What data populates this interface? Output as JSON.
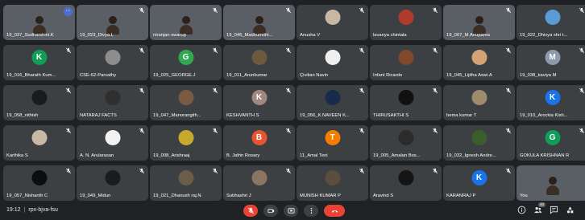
{
  "meeting": {
    "time": "19:12",
    "separator": "|",
    "code": "rpx-bjva-fsu"
  },
  "participants_badge": "40",
  "colors": {
    "background": "#202124",
    "tile": "#3c4043",
    "end_call": "#ea4335",
    "pin_badge": "#4b6fd1"
  },
  "tiles": [
    {
      "name": "19_037_Sudharshini.K",
      "avatar_type": "video",
      "photo": "pic-a",
      "dots": true
    },
    {
      "name": "19_023_Divya.L",
      "avatar_type": "video",
      "photo": "pic-b"
    },
    {
      "name": "niranjan swarup",
      "avatar_type": "video",
      "photo": "pic-c"
    },
    {
      "name": "19_046_Madhumithi...",
      "avatar_type": "video",
      "photo": "pic-d"
    },
    {
      "name": "Anusha V",
      "avatar_type": "photo",
      "avatar_color": "#c7b8a3"
    },
    {
      "name": "lavanya chintala",
      "avatar_type": "photo",
      "avatar_color": "#b03a2e"
    },
    {
      "name": "19_007_M.Anupama",
      "avatar_type": "video",
      "photo": "pic-e"
    },
    {
      "name": "19_022_Dhivya shri t...",
      "avatar_type": "photo",
      "avatar_color": "#5b9bd5"
    },
    {
      "name": "19_016_Bharath Kum...",
      "avatar_type": "letter",
      "letter": "K",
      "avatar_color": "#0f9d58"
    },
    {
      "name": "CSE-62-Parvathy",
      "avatar_type": "photo",
      "avatar_color": "#8d8d8d"
    },
    {
      "name": "19_025_GEORGE.J",
      "avatar_type": "letter",
      "letter": "G",
      "avatar_color": "#33a852"
    },
    {
      "name": "19_011_Arunkumar",
      "avatar_type": "photo",
      "avatar_color": "#6b5a3e"
    },
    {
      "name": "Çivilian Navin",
      "avatar_type": "photo",
      "avatar_color": "#efefef"
    },
    {
      "name": "Infant Ricardo",
      "avatar_type": "photo",
      "avatar_color": "#7e4a2b"
    },
    {
      "name": "19_045_Lijitha Aswi.A",
      "avatar_type": "photo",
      "avatar_color": "#d4a373"
    },
    {
      "name": "19_038_kaviya M",
      "avatar_type": "letter",
      "letter": "M",
      "avatar_color": "#8c9aab"
    },
    {
      "name": "19_058_nithish",
      "avatar_type": "photo",
      "avatar_color": "#1b1b1b"
    },
    {
      "name": "NATARAJ FACTS",
      "avatar_type": "photo",
      "avatar_color": "#2f2f2f"
    },
    {
      "name": "19_047_Manorangith...",
      "avatar_type": "photo",
      "avatar_color": "#7a5b41"
    },
    {
      "name": "KESHVANTH S",
      "avatar_type": "letter",
      "letter": "K",
      "avatar_color": "#a1887f"
    },
    {
      "name": "19_056_K.NAVEEN K...",
      "avatar_type": "photo",
      "avatar_color": "#1a2a4a"
    },
    {
      "name": "THIRUSAKTHI S",
      "avatar_type": "photo",
      "avatar_color": "#111111"
    },
    {
      "name": "hema kumar T",
      "avatar_type": "photo",
      "avatar_color": "#9e8a6d"
    },
    {
      "name": "19_010_Arockia Kish...",
      "avatar_type": "letter",
      "letter": "K",
      "avatar_color": "#1a73e8"
    },
    {
      "name": "Karthika S",
      "avatar_type": "photo",
      "avatar_color": "#c9b8a6"
    },
    {
      "name": "A. N. Arularasan",
      "avatar_type": "photo",
      "avatar_color": "#f2f2f2"
    },
    {
      "name": "19_008_Arishraaj",
      "avatar_type": "photo",
      "avatar_color": "#c8a82c"
    },
    {
      "name": "B. Jafrin Rosary",
      "avatar_type": "letter",
      "letter": "B",
      "avatar_color": "#e8542f"
    },
    {
      "name": "11_Amal Teni",
      "avatar_type": "letter",
      "letter": "T",
      "avatar_color": "#f57c00"
    },
    {
      "name": "19_005_Amalan Bos...",
      "avatar_type": "photo",
      "avatar_color": "#2b2b2b"
    },
    {
      "name": "19_032_Ignesh Andre...",
      "avatar_type": "photo",
      "avatar_color": "#3a5f2a"
    },
    {
      "name": "GOKULA KRISHNAN R",
      "avatar_type": "letter",
      "letter": "G",
      "avatar_color": "#0f9d58"
    },
    {
      "name": "19_057_Nishanth C",
      "avatar_type": "photo",
      "avatar_color": "#0d0d0d"
    },
    {
      "name": "19_049_Midun",
      "avatar_type": "photo",
      "avatar_color": "#1c1c1c"
    },
    {
      "name": "19_021_Dhanush raj.N",
      "avatar_type": "photo",
      "avatar_color": "#6d5c4a"
    },
    {
      "name": "Subhashri J",
      "avatar_type": "photo",
      "avatar_color": "#8a7560"
    },
    {
      "name": "MUNISH KUMAR P",
      "avatar_type": "photo",
      "avatar_color": "#5b4d40"
    },
    {
      "name": "Aravind S",
      "avatar_type": "photo",
      "avatar_color": "#141414"
    },
    {
      "name": "KARANRAJ P",
      "avatar_type": "letter",
      "letter": "K",
      "avatar_color": "#1a73e8"
    },
    {
      "name": "You",
      "avatar_type": "video",
      "photo": "pic-e",
      "self": true
    }
  ]
}
